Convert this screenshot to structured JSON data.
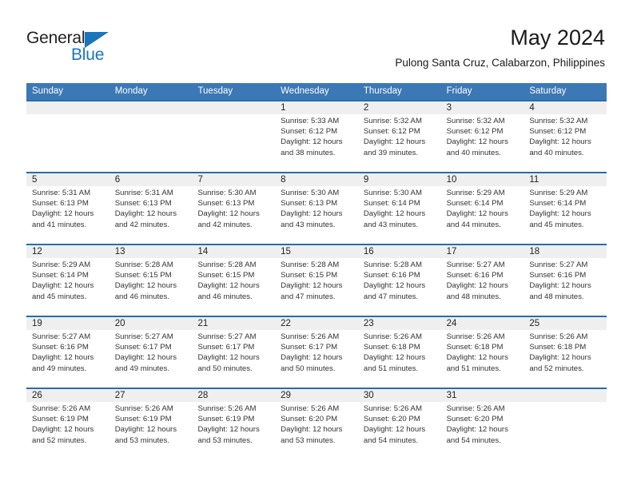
{
  "brand": {
    "name_part1": "General",
    "name_part2": "Blue",
    "triangle_color": "#1b75bb"
  },
  "header": {
    "title": "May 2024",
    "subtitle": "Pulong Santa Cruz, Calabarzon, Philippines"
  },
  "colors": {
    "header_blue": "#3b78b5",
    "row_divider": "#2b6ca8",
    "daynum_band": "#efefef"
  },
  "weekdays": [
    "Sunday",
    "Monday",
    "Tuesday",
    "Wednesday",
    "Thursday",
    "Friday",
    "Saturday"
  ],
  "weeks": [
    [
      {
        "day": "",
        "sunrise": "",
        "sunset": "",
        "daylight1": "",
        "daylight2": ""
      },
      {
        "day": "",
        "sunrise": "",
        "sunset": "",
        "daylight1": "",
        "daylight2": ""
      },
      {
        "day": "",
        "sunrise": "",
        "sunset": "",
        "daylight1": "",
        "daylight2": ""
      },
      {
        "day": "1",
        "sunrise": "Sunrise: 5:33 AM",
        "sunset": "Sunset: 6:12 PM",
        "daylight1": "Daylight: 12 hours",
        "daylight2": "and 38 minutes."
      },
      {
        "day": "2",
        "sunrise": "Sunrise: 5:32 AM",
        "sunset": "Sunset: 6:12 PM",
        "daylight1": "Daylight: 12 hours",
        "daylight2": "and 39 minutes."
      },
      {
        "day": "3",
        "sunrise": "Sunrise: 5:32 AM",
        "sunset": "Sunset: 6:12 PM",
        "daylight1": "Daylight: 12 hours",
        "daylight2": "and 40 minutes."
      },
      {
        "day": "4",
        "sunrise": "Sunrise: 5:32 AM",
        "sunset": "Sunset: 6:12 PM",
        "daylight1": "Daylight: 12 hours",
        "daylight2": "and 40 minutes."
      }
    ],
    [
      {
        "day": "5",
        "sunrise": "Sunrise: 5:31 AM",
        "sunset": "Sunset: 6:13 PM",
        "daylight1": "Daylight: 12 hours",
        "daylight2": "and 41 minutes."
      },
      {
        "day": "6",
        "sunrise": "Sunrise: 5:31 AM",
        "sunset": "Sunset: 6:13 PM",
        "daylight1": "Daylight: 12 hours",
        "daylight2": "and 42 minutes."
      },
      {
        "day": "7",
        "sunrise": "Sunrise: 5:30 AM",
        "sunset": "Sunset: 6:13 PM",
        "daylight1": "Daylight: 12 hours",
        "daylight2": "and 42 minutes."
      },
      {
        "day": "8",
        "sunrise": "Sunrise: 5:30 AM",
        "sunset": "Sunset: 6:13 PM",
        "daylight1": "Daylight: 12 hours",
        "daylight2": "and 43 minutes."
      },
      {
        "day": "9",
        "sunrise": "Sunrise: 5:30 AM",
        "sunset": "Sunset: 6:14 PM",
        "daylight1": "Daylight: 12 hours",
        "daylight2": "and 43 minutes."
      },
      {
        "day": "10",
        "sunrise": "Sunrise: 5:29 AM",
        "sunset": "Sunset: 6:14 PM",
        "daylight1": "Daylight: 12 hours",
        "daylight2": "and 44 minutes."
      },
      {
        "day": "11",
        "sunrise": "Sunrise: 5:29 AM",
        "sunset": "Sunset: 6:14 PM",
        "daylight1": "Daylight: 12 hours",
        "daylight2": "and 45 minutes."
      }
    ],
    [
      {
        "day": "12",
        "sunrise": "Sunrise: 5:29 AM",
        "sunset": "Sunset: 6:14 PM",
        "daylight1": "Daylight: 12 hours",
        "daylight2": "and 45 minutes."
      },
      {
        "day": "13",
        "sunrise": "Sunrise: 5:28 AM",
        "sunset": "Sunset: 6:15 PM",
        "daylight1": "Daylight: 12 hours",
        "daylight2": "and 46 minutes."
      },
      {
        "day": "14",
        "sunrise": "Sunrise: 5:28 AM",
        "sunset": "Sunset: 6:15 PM",
        "daylight1": "Daylight: 12 hours",
        "daylight2": "and 46 minutes."
      },
      {
        "day": "15",
        "sunrise": "Sunrise: 5:28 AM",
        "sunset": "Sunset: 6:15 PM",
        "daylight1": "Daylight: 12 hours",
        "daylight2": "and 47 minutes."
      },
      {
        "day": "16",
        "sunrise": "Sunrise: 5:28 AM",
        "sunset": "Sunset: 6:16 PM",
        "daylight1": "Daylight: 12 hours",
        "daylight2": "and 47 minutes."
      },
      {
        "day": "17",
        "sunrise": "Sunrise: 5:27 AM",
        "sunset": "Sunset: 6:16 PM",
        "daylight1": "Daylight: 12 hours",
        "daylight2": "and 48 minutes."
      },
      {
        "day": "18",
        "sunrise": "Sunrise: 5:27 AM",
        "sunset": "Sunset: 6:16 PM",
        "daylight1": "Daylight: 12 hours",
        "daylight2": "and 48 minutes."
      }
    ],
    [
      {
        "day": "19",
        "sunrise": "Sunrise: 5:27 AM",
        "sunset": "Sunset: 6:16 PM",
        "daylight1": "Daylight: 12 hours",
        "daylight2": "and 49 minutes."
      },
      {
        "day": "20",
        "sunrise": "Sunrise: 5:27 AM",
        "sunset": "Sunset: 6:17 PM",
        "daylight1": "Daylight: 12 hours",
        "daylight2": "and 49 minutes."
      },
      {
        "day": "21",
        "sunrise": "Sunrise: 5:27 AM",
        "sunset": "Sunset: 6:17 PM",
        "daylight1": "Daylight: 12 hours",
        "daylight2": "and 50 minutes."
      },
      {
        "day": "22",
        "sunrise": "Sunrise: 5:26 AM",
        "sunset": "Sunset: 6:17 PM",
        "daylight1": "Daylight: 12 hours",
        "daylight2": "and 50 minutes."
      },
      {
        "day": "23",
        "sunrise": "Sunrise: 5:26 AM",
        "sunset": "Sunset: 6:18 PM",
        "daylight1": "Daylight: 12 hours",
        "daylight2": "and 51 minutes."
      },
      {
        "day": "24",
        "sunrise": "Sunrise: 5:26 AM",
        "sunset": "Sunset: 6:18 PM",
        "daylight1": "Daylight: 12 hours",
        "daylight2": "and 51 minutes."
      },
      {
        "day": "25",
        "sunrise": "Sunrise: 5:26 AM",
        "sunset": "Sunset: 6:18 PM",
        "daylight1": "Daylight: 12 hours",
        "daylight2": "and 52 minutes."
      }
    ],
    [
      {
        "day": "26",
        "sunrise": "Sunrise: 5:26 AM",
        "sunset": "Sunset: 6:19 PM",
        "daylight1": "Daylight: 12 hours",
        "daylight2": "and 52 minutes."
      },
      {
        "day": "27",
        "sunrise": "Sunrise: 5:26 AM",
        "sunset": "Sunset: 6:19 PM",
        "daylight1": "Daylight: 12 hours",
        "daylight2": "and 53 minutes."
      },
      {
        "day": "28",
        "sunrise": "Sunrise: 5:26 AM",
        "sunset": "Sunset: 6:19 PM",
        "daylight1": "Daylight: 12 hours",
        "daylight2": "and 53 minutes."
      },
      {
        "day": "29",
        "sunrise": "Sunrise: 5:26 AM",
        "sunset": "Sunset: 6:20 PM",
        "daylight1": "Daylight: 12 hours",
        "daylight2": "and 53 minutes."
      },
      {
        "day": "30",
        "sunrise": "Sunrise: 5:26 AM",
        "sunset": "Sunset: 6:20 PM",
        "daylight1": "Daylight: 12 hours",
        "daylight2": "and 54 minutes."
      },
      {
        "day": "31",
        "sunrise": "Sunrise: 5:26 AM",
        "sunset": "Sunset: 6:20 PM",
        "daylight1": "Daylight: 12 hours",
        "daylight2": "and 54 minutes."
      },
      {
        "day": "",
        "sunrise": "",
        "sunset": "",
        "daylight1": "",
        "daylight2": ""
      }
    ]
  ]
}
